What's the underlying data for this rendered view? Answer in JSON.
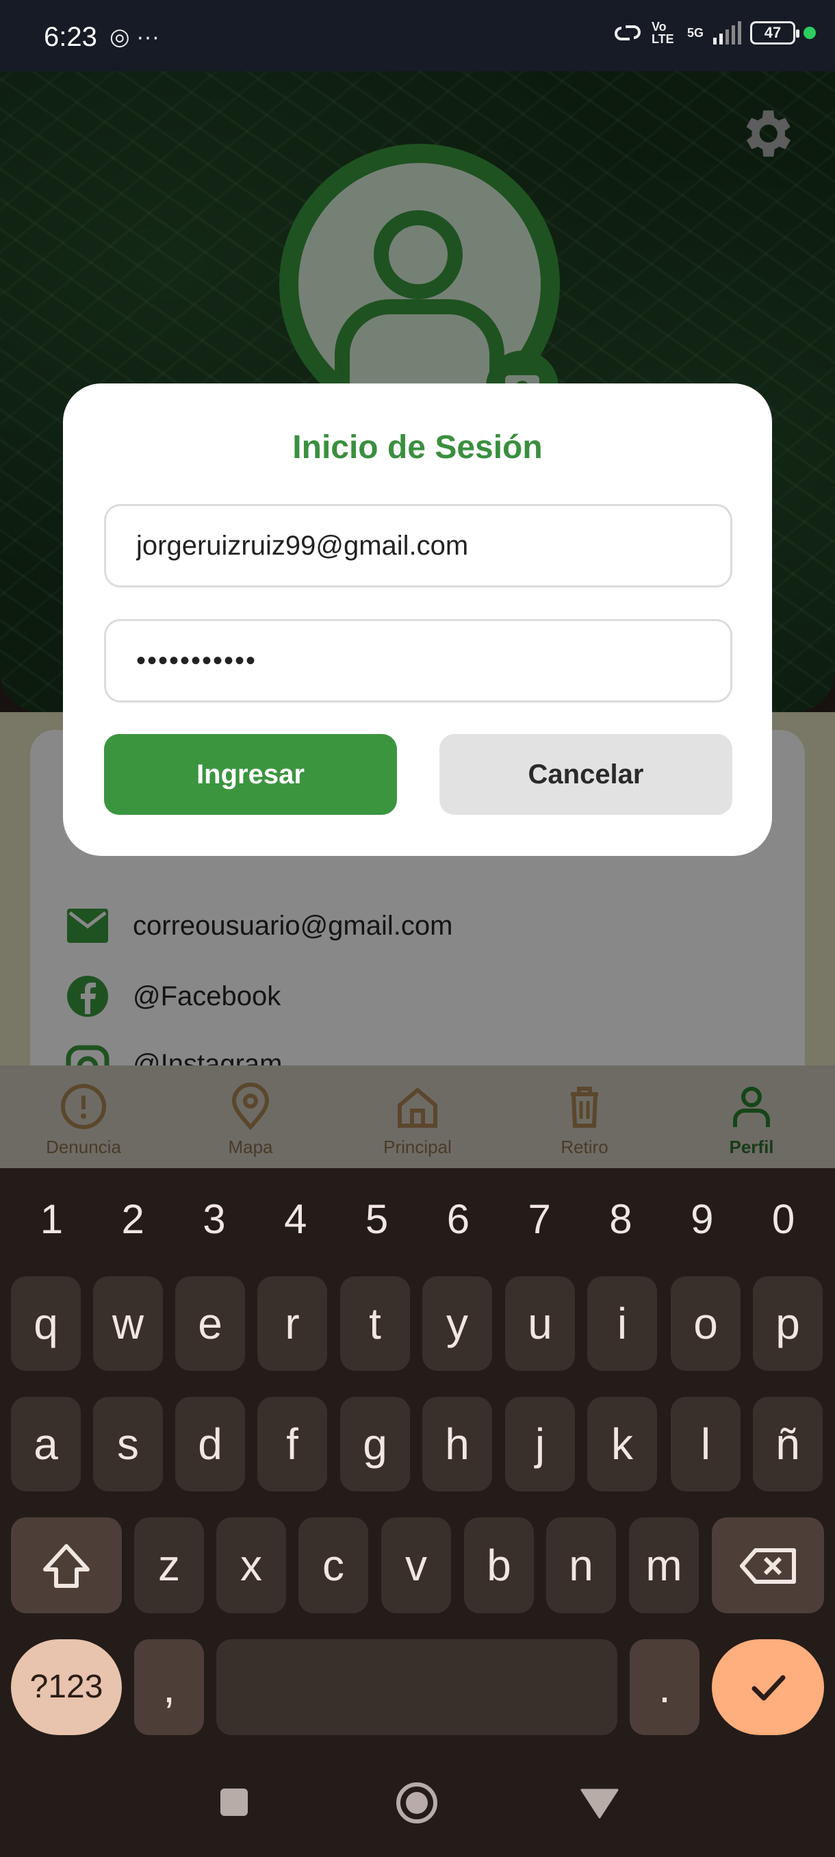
{
  "status_bar": {
    "time": "6:23",
    "left_icons": "◎ ···",
    "volte": "Vo LTE",
    "network": "5G",
    "battery": "47"
  },
  "header": {
    "settings_icon": "gear-icon",
    "avatar_icon": "user-icon",
    "camera_icon": "camera-icon"
  },
  "profile": {
    "email": "correousuario@gmail.com",
    "facebook": "@Facebook",
    "instagram": "@Instagram"
  },
  "dialog": {
    "title": "Inicio de Sesión",
    "email_value": "jorgeruizruiz99@gmail.com",
    "password_value": "•••••••••••",
    "login_label": "Ingresar",
    "cancel_label": "Cancelar"
  },
  "bottom_nav": {
    "items": [
      {
        "label": "Denuncia",
        "icon": "alert-circle-icon"
      },
      {
        "label": "Mapa",
        "icon": "map-pin-icon"
      },
      {
        "label": "Principal",
        "icon": "home-icon"
      },
      {
        "label": "Retiro",
        "icon": "trash-icon"
      },
      {
        "label": "Perfil",
        "icon": "user-icon"
      }
    ]
  },
  "keyboard": {
    "numbers": [
      "1",
      "2",
      "3",
      "4",
      "5",
      "6",
      "7",
      "8",
      "9",
      "0"
    ],
    "row1": [
      "q",
      "w",
      "e",
      "r",
      "t",
      "y",
      "u",
      "i",
      "o",
      "p"
    ],
    "row2": [
      "a",
      "s",
      "d",
      "f",
      "g",
      "h",
      "j",
      "k",
      "l",
      "ñ"
    ],
    "row3": [
      "z",
      "x",
      "c",
      "v",
      "b",
      "n",
      "m"
    ],
    "symbols_label": "?123",
    "comma": ",",
    "period": "."
  },
  "colors": {
    "brand_green": "#3b953f",
    "dark_green": "#2f7d33",
    "keyboard_bg": "#241c19",
    "enter_key": "#ffae7d"
  }
}
